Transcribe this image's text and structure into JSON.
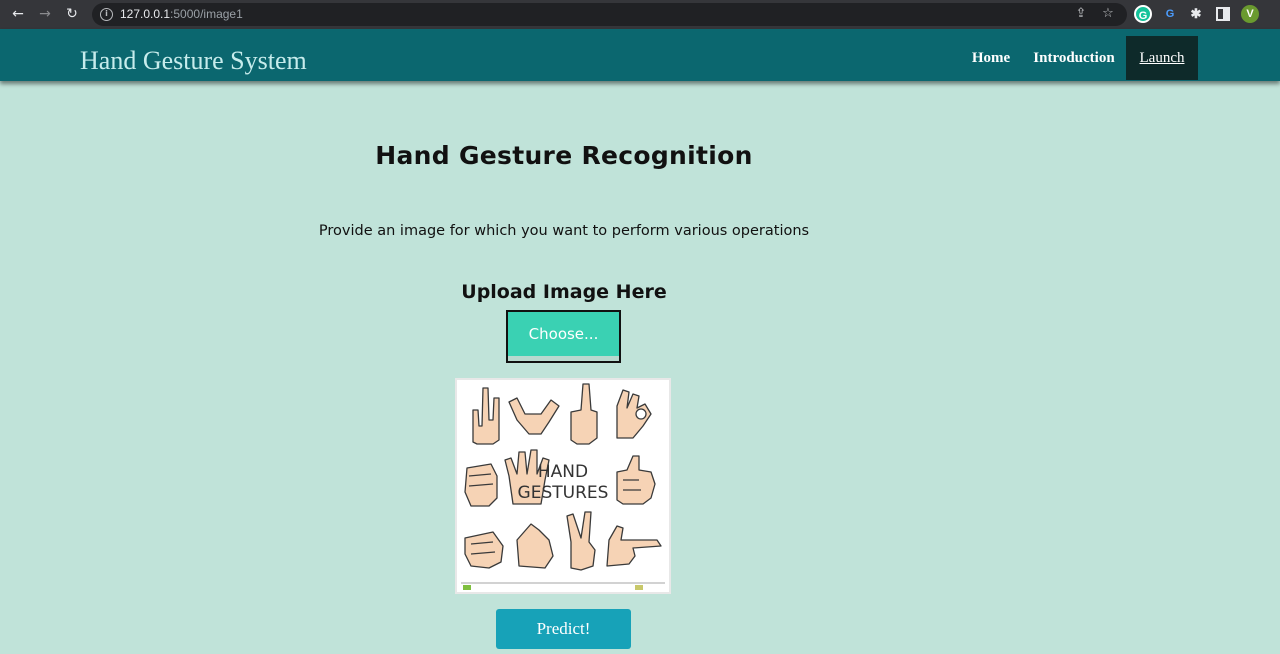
{
  "browser": {
    "url_host": "127.0.0.1",
    "url_rest": ":5000/image1",
    "profile_initial": "V",
    "extensions": [
      {
        "name": "grammarly-extension-icon",
        "glyph": "G",
        "bg": "#15c39a"
      },
      {
        "name": "google-extension-icon",
        "glyph": "G",
        "bg": "#3b82f6"
      }
    ]
  },
  "navbar": {
    "brand": "Hand Gesture System",
    "links": [
      {
        "label": "Home",
        "active": false
      },
      {
        "label": "Introduction",
        "active": false
      },
      {
        "label": "Launch",
        "active": true
      }
    ]
  },
  "main": {
    "title": "Hand Gesture Recognition",
    "subtitle": "Provide an image for which you want to perform various operations",
    "upload_heading": "Upload Image Here",
    "choose_label": "Choose...",
    "preview": {
      "line1": "HAND",
      "line2": "GESTURES"
    },
    "predict_label": "Predict!"
  },
  "colors": {
    "background": "#c0e3d9",
    "navbar": "#0b676f",
    "active_link": "#0e2a2a",
    "choose_button": "#3ad1b3",
    "predict_button": "#17a2b8"
  }
}
